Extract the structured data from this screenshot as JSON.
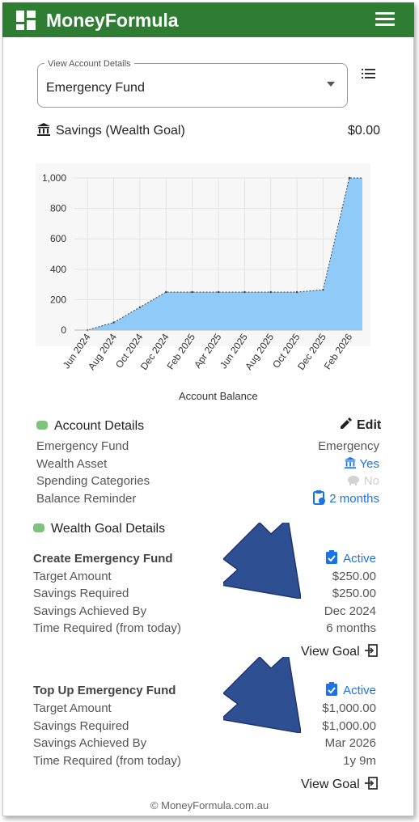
{
  "app": {
    "brand": "MoneyFormula"
  },
  "account_select": {
    "legend": "View Account Details",
    "value": "Emergency Fund"
  },
  "account": {
    "title": "Savings (Wealth Goal)",
    "balance": "$0.00"
  },
  "chart_data": {
    "type": "area",
    "x": [
      "Jun 2024",
      "Aug 2024",
      "Oct 2024",
      "Dec 2024",
      "Feb 2025",
      "Apr 2025",
      "Jun 2025",
      "Aug 2025",
      "Oct 2025",
      "Dec 2025",
      "Feb 2026"
    ],
    "series": [
      {
        "values": [
          0,
          50,
          150,
          250,
          250,
          250,
          250,
          250,
          250,
          265,
          1000
        ],
        "fill": "#90caf9"
      }
    ],
    "xlabel": "Account Balance",
    "ylim": [
      0,
      1000
    ],
    "yticks": [
      0,
      200,
      400,
      600,
      800,
      1000
    ],
    "ytick_labels": [
      "0",
      "200",
      "400",
      "600",
      "800",
      "1,000"
    ],
    "grid": true
  },
  "account_details": {
    "heading": "Account Details",
    "edit_label": "Edit",
    "rows": [
      {
        "label": "Emergency Fund",
        "value": "Emergency"
      },
      {
        "label": "Wealth Asset",
        "value": "Yes"
      },
      {
        "label": "Spending Categories",
        "value": "No"
      },
      {
        "label": "Balance Reminder",
        "value": "2 months"
      }
    ]
  },
  "wealth_goal": {
    "heading": "Wealth Goal Details",
    "goals": [
      {
        "name": "Create Emergency Fund",
        "status": "Active",
        "rows": [
          {
            "label": "Target Amount",
            "value": "$250.00"
          },
          {
            "label": "Savings Required",
            "value": "$250.00"
          },
          {
            "label": "Savings Achieved By",
            "value": "Dec 2024"
          },
          {
            "label": "Time Required (from today)",
            "value": "6 months"
          }
        ],
        "view_label": "View Goal"
      },
      {
        "name": "Top Up Emergency Fund",
        "status": "Active",
        "rows": [
          {
            "label": "Target Amount",
            "value": "$1,000.00"
          },
          {
            "label": "Savings Required",
            "value": "$1,000.00"
          },
          {
            "label": "Savings Achieved By",
            "value": "Mar 2026"
          },
          {
            "label": "Time Required (from today)",
            "value": "1y 9m"
          }
        ],
        "view_label": "View Goal"
      }
    ]
  },
  "footer": {
    "text": "© MoneyFormula.com.au"
  },
  "colors": {
    "brand_green": "#2e7d32",
    "link_blue": "#1a73e8",
    "area_fill": "#90caf9",
    "arrow": "#2f4f93"
  }
}
